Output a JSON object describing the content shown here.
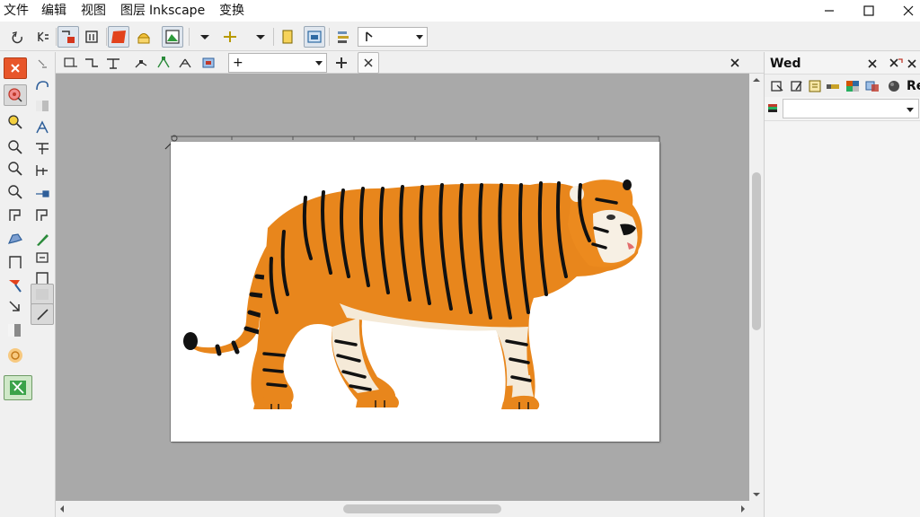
{
  "menu": {
    "items": [
      "文件",
      "编辑",
      "视图",
      "图层",
      "Inkscape",
      "变换"
    ]
  },
  "toolbar": {
    "zoom_value": "",
    "snap_value": "+"
  },
  "dock": {
    "title": "Wed",
    "tab_label": "Re"
  },
  "canvas": {
    "image": "tiger-illustration",
    "accent": "#e8861c"
  }
}
